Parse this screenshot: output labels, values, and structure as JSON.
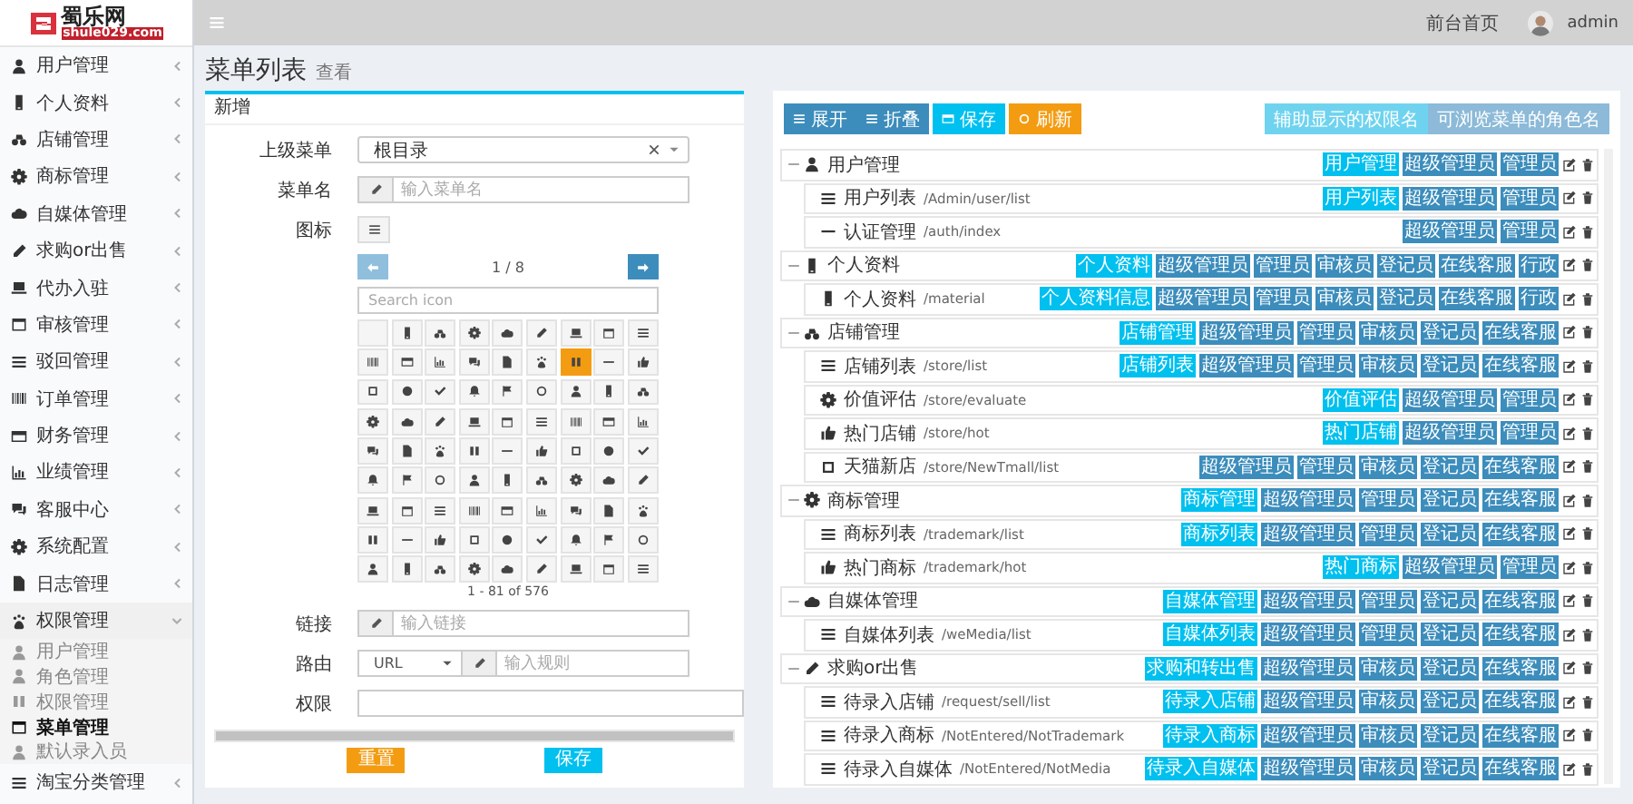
{
  "logo": {
    "name": "蜀乐网",
    "domain": "shule029.com"
  },
  "header": {
    "home_link": "前台首页",
    "user": "admin"
  },
  "sidebar": {
    "items": [
      {
        "label": "用户管理",
        "expanded": false
      },
      {
        "label": "个人资料",
        "expanded": false
      },
      {
        "label": "店铺管理",
        "expanded": false
      },
      {
        "label": "商标管理",
        "expanded": false
      },
      {
        "label": "自媒体管理",
        "expanded": false
      },
      {
        "label": "求购or出售",
        "expanded": false
      },
      {
        "label": "代办入驻",
        "expanded": false
      },
      {
        "label": "审核管理",
        "expanded": false
      },
      {
        "label": "驳回管理",
        "expanded": false
      },
      {
        "label": "订单管理",
        "expanded": false
      },
      {
        "label": "财务管理",
        "expanded": false
      },
      {
        "label": "业绩管理",
        "expanded": false
      },
      {
        "label": "客服中心",
        "expanded": false
      },
      {
        "label": "系统配置",
        "expanded": false
      },
      {
        "label": "日志管理",
        "expanded": false
      },
      {
        "label": "权限管理",
        "expanded": true,
        "children": [
          {
            "label": "用户管理",
            "selected": false
          },
          {
            "label": "角色管理",
            "selected": false
          },
          {
            "label": "权限管理",
            "selected": false
          },
          {
            "label": "菜单管理",
            "selected": true
          },
          {
            "label": "默认录入员",
            "selected": false
          }
        ]
      },
      {
        "label": "淘宝分类管理",
        "expanded": false
      }
    ]
  },
  "page": {
    "title": "菜单列表",
    "subtitle": "查看"
  },
  "form": {
    "title": "新增",
    "parent": {
      "label": "上级菜单",
      "value": "根目录"
    },
    "name": {
      "label": "菜单名",
      "placeholder": "输入菜单名"
    },
    "icon": {
      "label": "图标"
    },
    "icon_picker": {
      "page": "1 / 8",
      "prev": {
        "disabled": true
      },
      "next": {
        "disabled": false
      },
      "search_placeholder": "Search icon",
      "count": "1 - 81 of 576",
      "cells": [
        {
          "selected": false
        },
        {
          "selected": false
        },
        {
          "selected": false
        },
        {
          "selected": false
        },
        {
          "selected": false
        },
        {
          "selected": false
        },
        {
          "selected": false
        },
        {
          "selected": false
        },
        {
          "selected": false
        },
        {
          "selected": false
        },
        {
          "selected": false
        },
        {
          "selected": false
        },
        {
          "selected": false
        },
        {
          "selected": false
        },
        {
          "selected": false
        },
        {
          "selected": true
        },
        {
          "selected": false
        },
        {
          "selected": false
        },
        {
          "selected": false
        },
        {
          "selected": false
        },
        {
          "selected": false
        },
        {
          "selected": false
        },
        {
          "selected": false
        },
        {
          "selected": false
        },
        {
          "selected": false
        },
        {
          "selected": false
        },
        {
          "selected": false
        },
        {
          "selected": false
        },
        {
          "selected": false
        },
        {
          "selected": false
        },
        {
          "selected": false
        },
        {
          "selected": false
        },
        {
          "selected": false
        },
        {
          "selected": false
        },
        {
          "selected": false
        },
        {
          "selected": false
        },
        {
          "selected": false
        },
        {
          "selected": false
        },
        {
          "selected": false
        },
        {
          "selected": false
        },
        {
          "selected": false
        },
        {
          "selected": false
        },
        {
          "selected": false
        },
        {
          "selected": false
        },
        {
          "selected": false
        },
        {
          "selected": false
        },
        {
          "selected": false
        },
        {
          "selected": false
        },
        {
          "selected": false
        },
        {
          "selected": false
        },
        {
          "selected": false
        },
        {
          "selected": false
        },
        {
          "selected": false
        },
        {
          "selected": false
        },
        {
          "selected": false
        },
        {
          "selected": false
        },
        {
          "selected": false
        },
        {
          "selected": false
        },
        {
          "selected": false
        },
        {
          "selected": false
        },
        {
          "selected": false
        },
        {
          "selected": false
        },
        {
          "selected": false
        },
        {
          "selected": false
        },
        {
          "selected": false
        },
        {
          "selected": false
        },
        {
          "selected": false
        },
        {
          "selected": false
        },
        {
          "selected": false
        },
        {
          "selected": false
        },
        {
          "selected": false
        },
        {
          "selected": false
        },
        {
          "selected": false
        },
        {
          "selected": false
        },
        {
          "selected": false
        },
        {
          "selected": false
        },
        {
          "selected": false
        },
        {
          "selected": false
        },
        {
          "selected": false
        },
        {
          "selected": false
        },
        {
          "selected": false
        }
      ]
    },
    "link": {
      "label": "链接",
      "placeholder": "输入链接"
    },
    "route": {
      "label": "路由",
      "value": "URL",
      "placeholder": "输入规则"
    },
    "permission": {
      "label": "权限"
    },
    "buttons": [
      {
        "label": "重置",
        "color": "#f39c12"
      },
      {
        "label": "保存",
        "color": "#00c0ef"
      }
    ]
  },
  "tree_panel": {
    "toolbar": [
      {
        "label": "展开",
        "color": "#3c8dbc"
      },
      {
        "label": "折叠",
        "color": "#3c8dbc"
      },
      {
        "label": "保存",
        "color": "#00c0ef"
      },
      {
        "label": "刷新",
        "color": "#f39c12"
      }
    ],
    "toggles": [
      {
        "label": "辅助显示的权限名",
        "color": "#6fd3ef"
      },
      {
        "label": "可浏览菜单的角色名",
        "color": "#8cbad8"
      }
    ],
    "tree": [
      {
        "name": "用户管理",
        "permission": "用户管理",
        "roles": [
          "超级管理员",
          "管理员"
        ],
        "children": [
          {
            "name": "用户列表",
            "path": "/Admin/user/list",
            "permission": "用户列表",
            "roles": [
              "超级管理员",
              "管理员"
            ]
          },
          {
            "name": "认证管理",
            "path": "/auth/index",
            "roles": [
              "超级管理员",
              "管理员"
            ]
          }
        ]
      },
      {
        "name": "个人资料",
        "permission": "个人资料",
        "roles": [
          "超级管理员",
          "管理员",
          "审核员",
          "登记员",
          "在线客服",
          "行政"
        ],
        "children": [
          {
            "name": "个人资料",
            "path": "/material",
            "permission": "个人资料信息",
            "roles": [
              "超级管理员",
              "管理员",
              "审核员",
              "登记员",
              "在线客服",
              "行政"
            ]
          }
        ]
      },
      {
        "name": "店铺管理",
        "permission": "店铺管理",
        "roles": [
          "超级管理员",
          "管理员",
          "审核员",
          "登记员",
          "在线客服"
        ],
        "children": [
          {
            "name": "店铺列表",
            "path": "/store/list",
            "permission": "店铺列表",
            "roles": [
              "超级管理员",
              "管理员",
              "审核员",
              "登记员",
              "在线客服"
            ]
          },
          {
            "name": "价值评估",
            "path": "/store/evaluate",
            "permission": "价值评估",
            "roles": [
              "超级管理员",
              "管理员"
            ]
          },
          {
            "name": "热门店铺",
            "path": "/store/hot",
            "permission": "热门店铺",
            "roles": [
              "超级管理员",
              "管理员"
            ]
          },
          {
            "name": "天猫新店",
            "path": "/store/NewTmall/list",
            "roles": [
              "超级管理员",
              "管理员",
              "审核员",
              "登记员",
              "在线客服"
            ]
          }
        ]
      },
      {
        "name": "商标管理",
        "permission": "商标管理",
        "roles": [
          "超级管理员",
          "管理员",
          "登记员",
          "在线客服"
        ],
        "children": [
          {
            "name": "商标列表",
            "path": "/trademark/list",
            "permission": "商标列表",
            "roles": [
              "超级管理员",
              "管理员",
              "登记员",
              "在线客服"
            ]
          },
          {
            "name": "热门商标",
            "path": "/trademark/hot",
            "permission": "热门商标",
            "roles": [
              "超级管理员",
              "管理员"
            ]
          }
        ]
      },
      {
        "name": "自媒体管理",
        "permission": "自媒体管理",
        "roles": [
          "超级管理员",
          "管理员",
          "登记员",
          "在线客服"
        ],
        "children": [
          {
            "name": "自媒体列表",
            "path": "/weMedia/list",
            "permission": "自媒体列表",
            "roles": [
              "超级管理员",
              "管理员",
              "登记员",
              "在线客服"
            ]
          }
        ]
      },
      {
        "name": "求购or出售",
        "permission": "求购和转出售",
        "roles": [
          "超级管理员",
          "审核员",
          "登记员",
          "在线客服"
        ],
        "children": [
          {
            "name": "待录入店铺",
            "path": "/request/sell/list",
            "permission": "待录入店铺",
            "roles": [
              "超级管理员",
              "审核员",
              "登记员",
              "在线客服"
            ]
          },
          {
            "name": "待录入商标",
            "path": "/NotEntered/NotTrademark",
            "permission": "待录入商标",
            "roles": [
              "超级管理员",
              "审核员",
              "登记员",
              "在线客服"
            ]
          },
          {
            "name": "待录入自媒体",
            "path": "/NotEntered/NotMedia",
            "permission": "待录入自媒体",
            "roles": [
              "超级管理员",
              "审核员",
              "登记员",
              "在线客服"
            ]
          }
        ]
      }
    ]
  }
}
